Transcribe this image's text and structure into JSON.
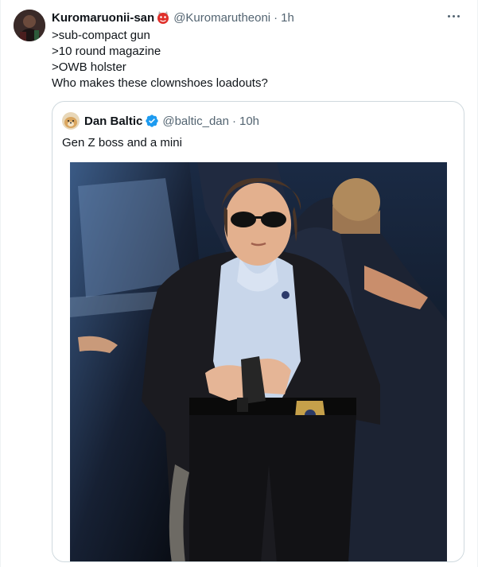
{
  "tweet": {
    "author": {
      "display_name": "Kuromaruonii-san",
      "handle": "@Kuromarutheoni",
      "separator": "·",
      "time": "1h"
    },
    "lines": [
      ">sub-compact gun",
      ">10 round magazine",
      ">OWB holster",
      "Who makes these clownshoes loadouts?"
    ],
    "quote": {
      "display_name": "Dan Baltic",
      "handle": "@baltic_dan",
      "separator": "·",
      "time": "10h",
      "text": "Gen Z boss and a mini"
    }
  },
  "colors": {
    "text_primary": "#0f1419",
    "text_secondary": "#536471",
    "verified_blue": "#1d9bf0",
    "quote_border": "#cfd9de"
  },
  "icons": {
    "more": "more-options-icon",
    "verified": "verified-badge-icon",
    "emoji": "red-oni-emoji-icon"
  }
}
